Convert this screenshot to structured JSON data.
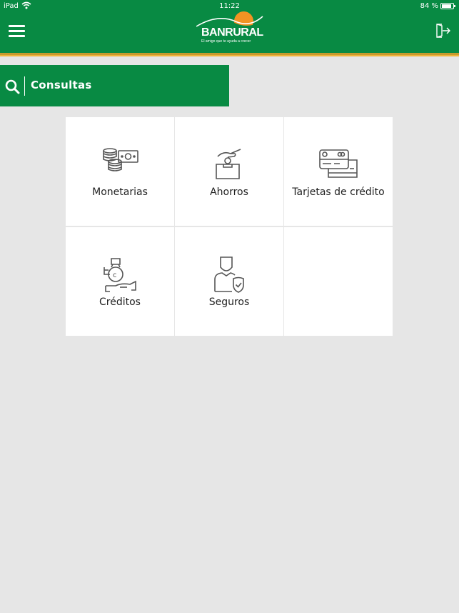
{
  "status_bar": {
    "carrier": "iPad",
    "time": "11:22",
    "battery": "84 %"
  },
  "header": {
    "brand": "BANRURAL",
    "tagline": "El amigo que te ayuda a crecer",
    "menu_icon": "hamburger-menu-icon",
    "logout_icon": "logout-icon"
  },
  "section": {
    "title": "Consultas",
    "icon": "search-icon"
  },
  "tiles": [
    {
      "label": "Monetarias",
      "icon": "money-icon"
    },
    {
      "label": "Ahorros",
      "icon": "savings-deposit-icon"
    },
    {
      "label": "Tarjetas de crédito",
      "icon": "credit-cards-icon"
    },
    {
      "label": "Créditos",
      "icon": "loan-money-bag-icon"
    },
    {
      "label": "Seguros",
      "icon": "insurance-user-shield-icon"
    }
  ],
  "colors": {
    "primary_green": "#088a43",
    "accent_orange": "#f39323",
    "accent_gold": "#f0b43a",
    "background": "#e6e6e6",
    "icon_gray": "#555555"
  }
}
